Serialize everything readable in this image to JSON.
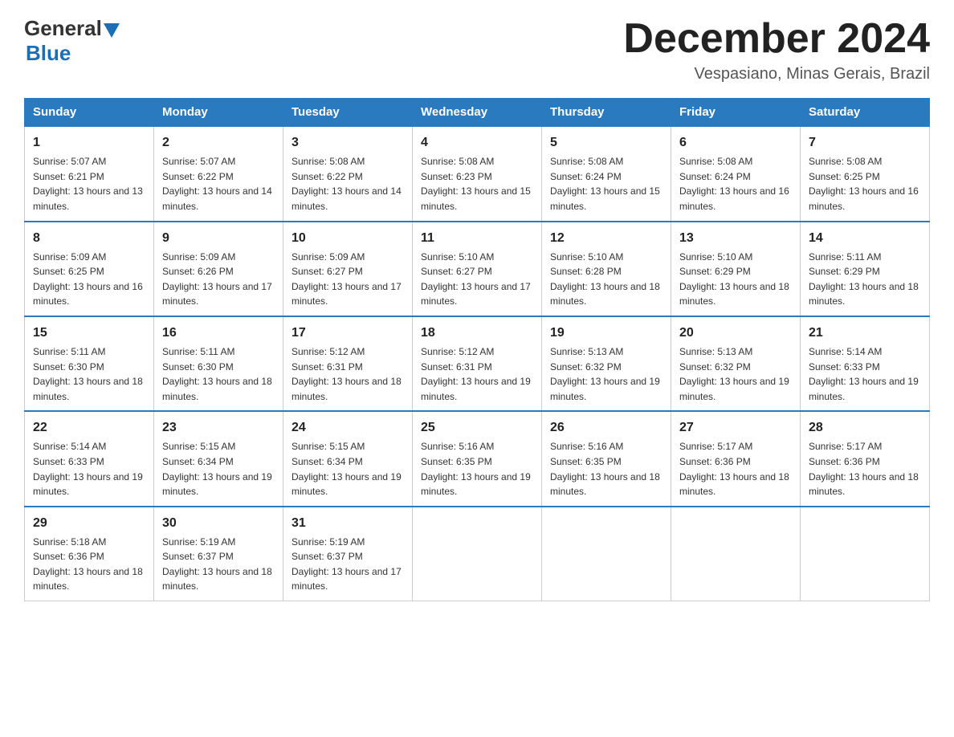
{
  "logo": {
    "general": "General",
    "blue": "Blue"
  },
  "header": {
    "title": "December 2024",
    "location": "Vespasiano, Minas Gerais, Brazil"
  },
  "weekdays": [
    "Sunday",
    "Monday",
    "Tuesday",
    "Wednesday",
    "Thursday",
    "Friday",
    "Saturday"
  ],
  "weeks": [
    [
      {
        "day": "1",
        "sunrise": "5:07 AM",
        "sunset": "6:21 PM",
        "daylight": "13 hours and 13 minutes."
      },
      {
        "day": "2",
        "sunrise": "5:07 AM",
        "sunset": "6:22 PM",
        "daylight": "13 hours and 14 minutes."
      },
      {
        "day": "3",
        "sunrise": "5:08 AM",
        "sunset": "6:22 PM",
        "daylight": "13 hours and 14 minutes."
      },
      {
        "day": "4",
        "sunrise": "5:08 AM",
        "sunset": "6:23 PM",
        "daylight": "13 hours and 15 minutes."
      },
      {
        "day": "5",
        "sunrise": "5:08 AM",
        "sunset": "6:24 PM",
        "daylight": "13 hours and 15 minutes."
      },
      {
        "day": "6",
        "sunrise": "5:08 AM",
        "sunset": "6:24 PM",
        "daylight": "13 hours and 16 minutes."
      },
      {
        "day": "7",
        "sunrise": "5:08 AM",
        "sunset": "6:25 PM",
        "daylight": "13 hours and 16 minutes."
      }
    ],
    [
      {
        "day": "8",
        "sunrise": "5:09 AM",
        "sunset": "6:25 PM",
        "daylight": "13 hours and 16 minutes."
      },
      {
        "day": "9",
        "sunrise": "5:09 AM",
        "sunset": "6:26 PM",
        "daylight": "13 hours and 17 minutes."
      },
      {
        "day": "10",
        "sunrise": "5:09 AM",
        "sunset": "6:27 PM",
        "daylight": "13 hours and 17 minutes."
      },
      {
        "day": "11",
        "sunrise": "5:10 AM",
        "sunset": "6:27 PM",
        "daylight": "13 hours and 17 minutes."
      },
      {
        "day": "12",
        "sunrise": "5:10 AM",
        "sunset": "6:28 PM",
        "daylight": "13 hours and 18 minutes."
      },
      {
        "day": "13",
        "sunrise": "5:10 AM",
        "sunset": "6:29 PM",
        "daylight": "13 hours and 18 minutes."
      },
      {
        "day": "14",
        "sunrise": "5:11 AM",
        "sunset": "6:29 PM",
        "daylight": "13 hours and 18 minutes."
      }
    ],
    [
      {
        "day": "15",
        "sunrise": "5:11 AM",
        "sunset": "6:30 PM",
        "daylight": "13 hours and 18 minutes."
      },
      {
        "day": "16",
        "sunrise": "5:11 AM",
        "sunset": "6:30 PM",
        "daylight": "13 hours and 18 minutes."
      },
      {
        "day": "17",
        "sunrise": "5:12 AM",
        "sunset": "6:31 PM",
        "daylight": "13 hours and 18 minutes."
      },
      {
        "day": "18",
        "sunrise": "5:12 AM",
        "sunset": "6:31 PM",
        "daylight": "13 hours and 19 minutes."
      },
      {
        "day": "19",
        "sunrise": "5:13 AM",
        "sunset": "6:32 PM",
        "daylight": "13 hours and 19 minutes."
      },
      {
        "day": "20",
        "sunrise": "5:13 AM",
        "sunset": "6:32 PM",
        "daylight": "13 hours and 19 minutes."
      },
      {
        "day": "21",
        "sunrise": "5:14 AM",
        "sunset": "6:33 PM",
        "daylight": "13 hours and 19 minutes."
      }
    ],
    [
      {
        "day": "22",
        "sunrise": "5:14 AM",
        "sunset": "6:33 PM",
        "daylight": "13 hours and 19 minutes."
      },
      {
        "day": "23",
        "sunrise": "5:15 AM",
        "sunset": "6:34 PM",
        "daylight": "13 hours and 19 minutes."
      },
      {
        "day": "24",
        "sunrise": "5:15 AM",
        "sunset": "6:34 PM",
        "daylight": "13 hours and 19 minutes."
      },
      {
        "day": "25",
        "sunrise": "5:16 AM",
        "sunset": "6:35 PM",
        "daylight": "13 hours and 19 minutes."
      },
      {
        "day": "26",
        "sunrise": "5:16 AM",
        "sunset": "6:35 PM",
        "daylight": "13 hours and 18 minutes."
      },
      {
        "day": "27",
        "sunrise": "5:17 AM",
        "sunset": "6:36 PM",
        "daylight": "13 hours and 18 minutes."
      },
      {
        "day": "28",
        "sunrise": "5:17 AM",
        "sunset": "6:36 PM",
        "daylight": "13 hours and 18 minutes."
      }
    ],
    [
      {
        "day": "29",
        "sunrise": "5:18 AM",
        "sunset": "6:36 PM",
        "daylight": "13 hours and 18 minutes."
      },
      {
        "day": "30",
        "sunrise": "5:19 AM",
        "sunset": "6:37 PM",
        "daylight": "13 hours and 18 minutes."
      },
      {
        "day": "31",
        "sunrise": "5:19 AM",
        "sunset": "6:37 PM",
        "daylight": "13 hours and 17 minutes."
      },
      null,
      null,
      null,
      null
    ]
  ]
}
